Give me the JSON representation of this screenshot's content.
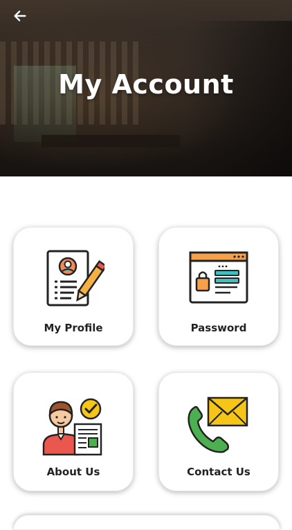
{
  "header": {
    "title": "My Account",
    "back_icon": "arrow-left-icon"
  },
  "menu": {
    "items": [
      {
        "label": "My Profile",
        "icon": "profile-document-icon"
      },
      {
        "label": "Password",
        "icon": "password-lock-icon"
      },
      {
        "label": "About Us",
        "icon": "about-person-icon"
      },
      {
        "label": "Contact Us",
        "icon": "phone-envelope-icon"
      }
    ]
  },
  "colors": {
    "card_background": "#ffffff",
    "text": "#222222",
    "accent_orange": "#f5a14a",
    "accent_teal": "#3fc1c0",
    "accent_green": "#4caf50"
  }
}
